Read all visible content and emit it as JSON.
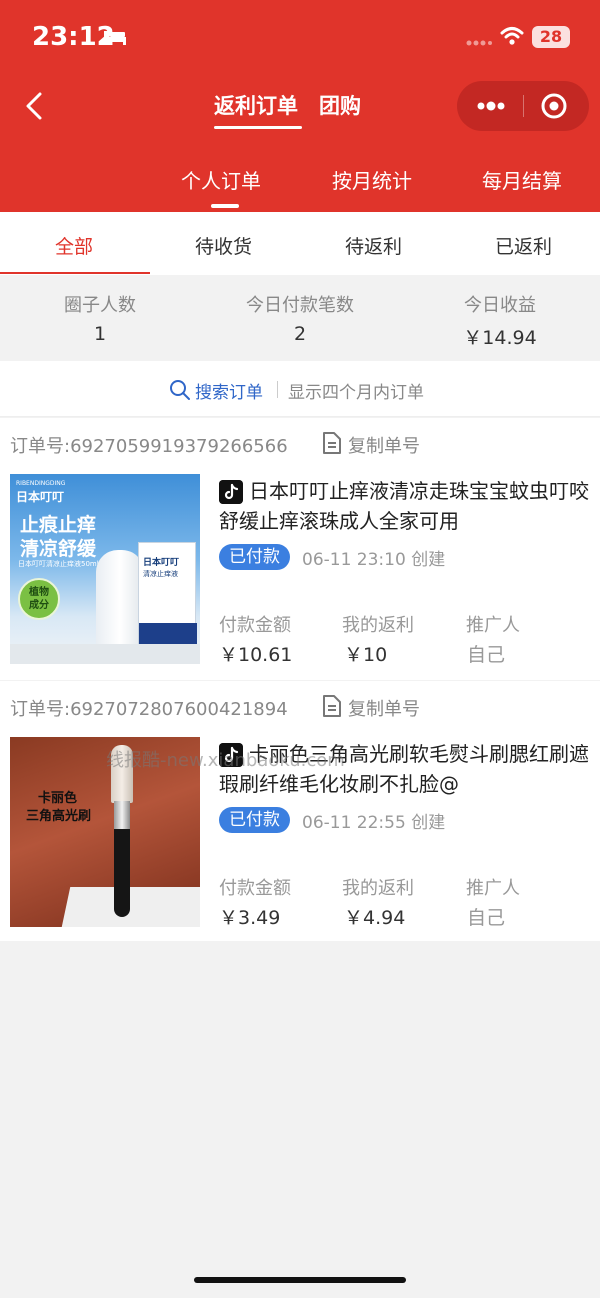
{
  "status_bar": {
    "time": "23:12",
    "battery": "28"
  },
  "nav": {
    "title": "返利订单",
    "group_tab": "团购"
  },
  "sub_tabs": [
    "个人订单",
    "按月统计",
    "每月结算"
  ],
  "filter_tabs": [
    "全部",
    "待收货",
    "待返利",
    "已返利"
  ],
  "stats": [
    {
      "label": "圈子人数",
      "value": "1"
    },
    {
      "label": "今日付款笔数",
      "value": "2"
    },
    {
      "label": "今日收益",
      "value": "￥14.94"
    }
  ],
  "search": {
    "label": "搜索订单",
    "hint": "显示四个月内订单"
  },
  "copy_label": "复制单号",
  "meta_labels": {
    "amount": "付款金额",
    "rebate": "我的返利",
    "promoter": "推广人"
  },
  "orders": [
    {
      "order_no": "订单号:6927059919379266566",
      "title": "日本叮叮止痒液清凉走珠宝宝蚊虫叮咬舒缓止痒滚珠成人全家可用",
      "status": "已付款",
      "created": "06-11 23:10 创建",
      "amount": "￥10.61",
      "rebate": "￥10",
      "promoter": "自己",
      "image_text": {
        "brand_en": "RIBENDINGDING",
        "brand_cn": "日本叮叮",
        "headline1": "止痕止痒",
        "headline2": "清凉舒缓",
        "sub": "日本叮叮清凉止痒液50ml",
        "badge": "植物成分",
        "box_brand": "日本叮叮",
        "box_sub": "清凉止痒液"
      }
    },
    {
      "order_no": "订单号:6927072807600421894",
      "title": "卡丽色三角高光刷软毛熨斗刷腮红刷遮瑕刷纤维毛化妆刷不扎脸@",
      "status": "已付款",
      "created": "06-11 22:55 创建",
      "amount": "￥3.49",
      "rebate": "￥4.94",
      "promoter": "自己",
      "image_text": {
        "line1": "卡丽色",
        "line2": "三角高光刷"
      }
    }
  ],
  "watermark": "线报酷-new.xianbaoku.com",
  "colors": {
    "brand_red": "#e0342b",
    "badge_blue": "#3b7fe0",
    "link_blue": "#2f66c8"
  }
}
